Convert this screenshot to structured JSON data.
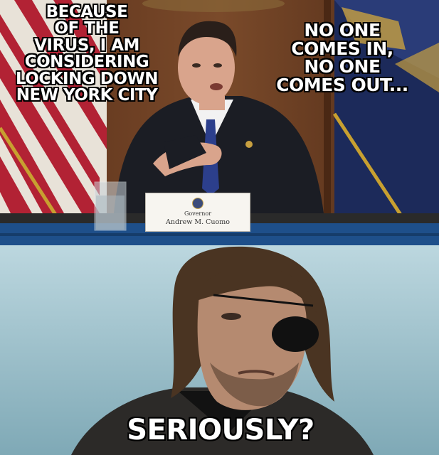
{
  "meme": {
    "top_left_caption": "BECAUSE\nOF THE\nVIRUS, I AM\nCONSIDERING\nLOCKING DOWN\nNEW YORK CITY",
    "top_right_caption": "NO ONE\nCOMES IN,\nNO ONE\nCOMES OUT...",
    "bottom_caption": "SERIOUSLY?"
  },
  "nameplate": {
    "title": "Governor",
    "name": "Andrew M. Cuomo"
  },
  "colors": {
    "caption_fill": "#ffffff",
    "caption_outline": "#000000",
    "wood_panel": "#6b3d22",
    "desk_blue": "#1e4f8a",
    "sky_blue": "#9fc3cf"
  }
}
